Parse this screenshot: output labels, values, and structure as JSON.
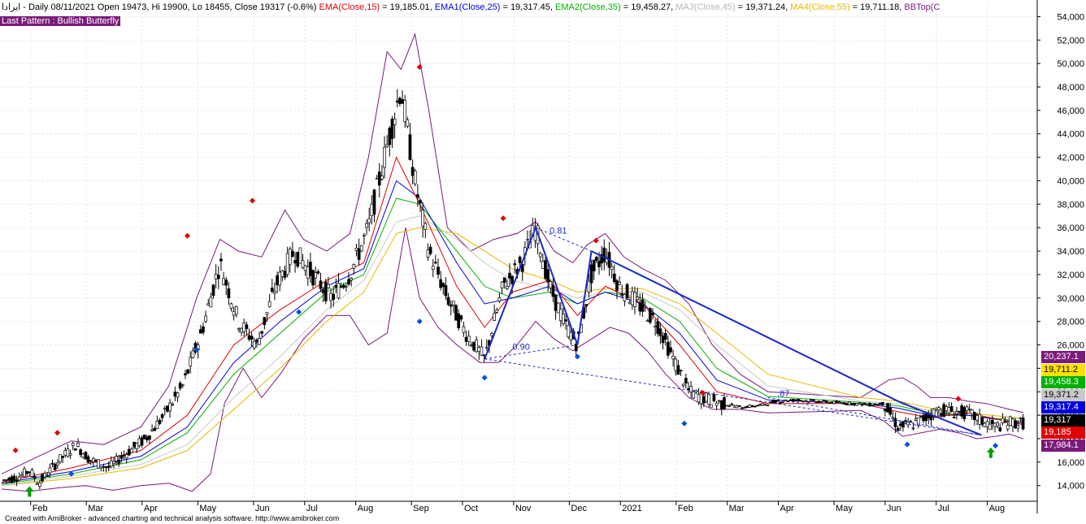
{
  "header": {
    "symbol": "ایرادا",
    "segments": [
      {
        "text": " - Daily 08/11/2021 Open 19473, Hi 19900, Lo 18455, Close 19317 (-0.6%) ",
        "color": "#000000"
      },
      {
        "text": "EMA(Close,15)",
        "color": "#e00000"
      },
      {
        "text": " = 19,185.01, ",
        "color": "#000000"
      },
      {
        "text": "EMA1(Close,25)",
        "color": "#0000e0"
      },
      {
        "text": " = 19,317.45, ",
        "color": "#000000"
      },
      {
        "text": "EMA2(Close,35)",
        "color": "#00b000"
      },
      {
        "text": " = 19,458.27, ",
        "color": "#000000"
      },
      {
        "text": "MA3(Close,45)",
        "color": "#b8b8b8"
      },
      {
        "text": " = 19,371.24, ",
        "color": "#000000"
      },
      {
        "text": "MA4(Close,55)",
        "color": "#e8b800"
      },
      {
        "text": " = 19,711.18, ",
        "color": "#000000"
      },
      {
        "text": "BBTop(C",
        "color": "#7a1a7a"
      }
    ]
  },
  "pattern_label": "Last Pattern : Bullish Butterfly",
  "footer": "Created with AmiBroker - advanced charting and technical analysis software. http://www.amibroker.com",
  "chart_data": {
    "type": "candlestick",
    "ylim": [
      12800,
      55000
    ],
    "y_ticks": [
      14000,
      16000,
      18000,
      20000,
      22000,
      24000,
      26000,
      28000,
      30000,
      32000,
      34000,
      36000,
      38000,
      40000,
      42000,
      44000,
      46000,
      48000,
      50000,
      52000,
      54000
    ],
    "y_tick_labels": [
      "14,000",
      "16,000",
      "18,000",
      "20,000",
      "22,000",
      "24,000",
      "26,000",
      "28,000",
      "30,000",
      "32,000",
      "34,000",
      "36,000",
      "38,000",
      "40,000",
      "42,000",
      "44,000",
      "46,000",
      "48,000",
      "50,000",
      "52,000",
      "54,000"
    ],
    "x_labels": [
      {
        "label": "Feb",
        "x": 0.8
      },
      {
        "label": "Mar",
        "x": 2.0
      },
      {
        "label": "Apr",
        "x": 3.2
      },
      {
        "label": "May",
        "x": 4.4
      },
      {
        "label": "Jun",
        "x": 5.6
      },
      {
        "label": "Jul",
        "x": 6.7
      },
      {
        "label": "Aug",
        "x": 7.8
      },
      {
        "label": "Sep",
        "x": 9.0
      },
      {
        "label": "Oct",
        "x": 10.1
      },
      {
        "label": "Nov",
        "x": 11.2
      },
      {
        "label": "Dec",
        "x": 12.4
      },
      {
        "label": "2021",
        "x": 13.5
      },
      {
        "label": "Feb",
        "x": 14.7
      },
      {
        "label": "Mar",
        "x": 15.8
      },
      {
        "label": "Apr",
        "x": 16.9
      },
      {
        "label": "May",
        "x": 18.1
      },
      {
        "label": "Jun",
        "x": 19.2
      },
      {
        "label": "Jul",
        "x": 20.3
      },
      {
        "label": "Aug",
        "x": 21.4
      }
    ],
    "x_range": [
      0,
      22.3
    ],
    "price_path": [
      [
        0.0,
        14400
      ],
      [
        0.4,
        14800
      ],
      [
        0.6,
        15300
      ],
      [
        0.8,
        14200
      ],
      [
        1.2,
        16000
      ],
      [
        1.6,
        17500
      ],
      [
        1.9,
        16200
      ],
      [
        2.3,
        15500
      ],
      [
        2.7,
        16800
      ],
      [
        3.1,
        18000
      ],
      [
        3.5,
        20000
      ],
      [
        3.9,
        22500
      ],
      [
        4.3,
        27000
      ],
      [
        4.7,
        33000
      ],
      [
        5.1,
        28000
      ],
      [
        5.5,
        26000
      ],
      [
        5.9,
        31000
      ],
      [
        6.3,
        34000
      ],
      [
        6.7,
        32000
      ],
      [
        7.1,
        30000
      ],
      [
        7.5,
        32000
      ],
      [
        7.9,
        36000
      ],
      [
        8.3,
        43000
      ],
      [
        8.6,
        48000
      ],
      [
        8.9,
        40000
      ],
      [
        9.2,
        34000
      ],
      [
        9.6,
        30000
      ],
      [
        10.0,
        27000
      ],
      [
        10.4,
        24800
      ],
      [
        10.8,
        31000
      ],
      [
        11.2,
        33000
      ],
      [
        11.5,
        36000
      ],
      [
        11.8,
        31000
      ],
      [
        12.1,
        28000
      ],
      [
        12.4,
        26000
      ],
      [
        12.7,
        32000
      ],
      [
        13.0,
        34000
      ],
      [
        13.3,
        31000
      ],
      [
        13.7,
        29500
      ],
      [
        14.1,
        28000
      ],
      [
        14.5,
        24500
      ],
      [
        14.8,
        22000
      ],
      [
        15.1,
        21500
      ],
      [
        15.5,
        21000
      ],
      [
        15.9,
        20700
      ],
      [
        16.3,
        20800
      ],
      [
        16.7,
        21200
      ],
      [
        17.1,
        21300
      ],
      [
        17.5,
        21200
      ],
      [
        17.9,
        21100
      ],
      [
        18.3,
        21000
      ],
      [
        18.7,
        20900
      ],
      [
        19.0,
        21000
      ],
      [
        19.3,
        19000
      ],
      [
        19.6,
        19200
      ],
      [
        19.9,
        19800
      ],
      [
        20.2,
        20500
      ],
      [
        20.5,
        20300
      ],
      [
        20.8,
        20200
      ],
      [
        21.1,
        19500
      ],
      [
        21.4,
        19000
      ],
      [
        21.7,
        19400
      ],
      [
        22.0,
        19317
      ]
    ],
    "ema15_path": [
      [
        0.0,
        14300
      ],
      [
        1.5,
        15500
      ],
      [
        3.0,
        17000
      ],
      [
        4.0,
        20000
      ],
      [
        5.0,
        26000
      ],
      [
        6.0,
        29000
      ],
      [
        7.0,
        31500
      ],
      [
        7.8,
        33000
      ],
      [
        8.5,
        42000
      ],
      [
        9.0,
        38000
      ],
      [
        9.8,
        31000
      ],
      [
        10.4,
        27500
      ],
      [
        11.0,
        30500
      ],
      [
        11.8,
        31500
      ],
      [
        12.4,
        28500
      ],
      [
        13.0,
        31000
      ],
      [
        13.8,
        29500
      ],
      [
        14.6,
        26000
      ],
      [
        15.4,
        22000
      ],
      [
        16.5,
        21000
      ],
      [
        18.5,
        21000
      ],
      [
        19.3,
        20300
      ],
      [
        20.0,
        19800
      ],
      [
        20.8,
        20200
      ],
      [
        22.0,
        19185
      ]
    ],
    "ema25_path": [
      [
        0.0,
        14200
      ],
      [
        1.5,
        15200
      ],
      [
        3.0,
        16500
      ],
      [
        4.0,
        19000
      ],
      [
        5.0,
        24500
      ],
      [
        6.0,
        28000
      ],
      [
        7.0,
        31000
      ],
      [
        7.8,
        32500
      ],
      [
        8.5,
        40000
      ],
      [
        9.0,
        38500
      ],
      [
        9.8,
        33000
      ],
      [
        10.4,
        29500
      ],
      [
        11.0,
        30000
      ],
      [
        11.8,
        31000
      ],
      [
        12.4,
        29500
      ],
      [
        13.0,
        30500
      ],
      [
        13.8,
        29500
      ],
      [
        14.6,
        27000
      ],
      [
        15.4,
        23000
      ],
      [
        16.5,
        21300
      ],
      [
        18.5,
        21000
      ],
      [
        19.3,
        20600
      ],
      [
        20.0,
        20000
      ],
      [
        20.8,
        20000
      ],
      [
        22.0,
        19317
      ]
    ],
    "ema35_path": [
      [
        0.0,
        14100
      ],
      [
        1.5,
        15000
      ],
      [
        3.0,
        16200
      ],
      [
        4.0,
        18500
      ],
      [
        5.0,
        23500
      ],
      [
        6.0,
        27000
      ],
      [
        7.0,
        30500
      ],
      [
        7.8,
        32000
      ],
      [
        8.5,
        38500
      ],
      [
        9.0,
        38000
      ],
      [
        9.8,
        34000
      ],
      [
        10.4,
        31000
      ],
      [
        11.0,
        30000
      ],
      [
        11.8,
        30500
      ],
      [
        12.4,
        29500
      ],
      [
        13.0,
        30500
      ],
      [
        13.8,
        30000
      ],
      [
        14.6,
        28000
      ],
      [
        15.4,
        24000
      ],
      [
        16.5,
        21600
      ],
      [
        18.5,
        21100
      ],
      [
        19.3,
        20800
      ],
      [
        20.0,
        20200
      ],
      [
        20.8,
        20000
      ],
      [
        22.0,
        19458
      ]
    ],
    "ma45_path": [
      [
        0.0,
        14000
      ],
      [
        1.5,
        14800
      ],
      [
        3.0,
        15800
      ],
      [
        4.0,
        17500
      ],
      [
        5.0,
        21500
      ],
      [
        6.0,
        25000
      ],
      [
        7.0,
        29000
      ],
      [
        7.8,
        31500
      ],
      [
        8.5,
        36500
      ],
      [
        9.0,
        37000
      ],
      [
        9.8,
        35000
      ],
      [
        10.4,
        33000
      ],
      [
        11.0,
        31500
      ],
      [
        11.8,
        30800
      ],
      [
        12.4,
        30000
      ],
      [
        13.0,
        30500
      ],
      [
        13.8,
        30500
      ],
      [
        14.6,
        29000
      ],
      [
        15.4,
        26000
      ],
      [
        16.5,
        22500
      ],
      [
        18.5,
        21200
      ],
      [
        19.3,
        21000
      ],
      [
        20.0,
        20400
      ],
      [
        20.8,
        20000
      ],
      [
        22.0,
        19371
      ]
    ],
    "ma55_path": [
      [
        0.0,
        14000
      ],
      [
        1.5,
        14600
      ],
      [
        3.0,
        15500
      ],
      [
        4.0,
        17000
      ],
      [
        5.0,
        20500
      ],
      [
        6.0,
        24000
      ],
      [
        7.0,
        28000
      ],
      [
        7.8,
        30500
      ],
      [
        8.5,
        35500
      ],
      [
        9.0,
        36000
      ],
      [
        9.8,
        35500
      ],
      [
        10.4,
        34000
      ],
      [
        11.0,
        32500
      ],
      [
        11.8,
        31500
      ],
      [
        12.4,
        30500
      ],
      [
        13.0,
        30800
      ],
      [
        13.8,
        30800
      ],
      [
        14.6,
        29500
      ],
      [
        15.4,
        27000
      ],
      [
        16.5,
        23500
      ],
      [
        18.5,
        21500
      ],
      [
        19.3,
        21200
      ],
      [
        20.0,
        20600
      ],
      [
        20.8,
        20200
      ],
      [
        22.0,
        19711
      ]
    ],
    "bb_top_path": [
      [
        0.0,
        15000
      ],
      [
        0.8,
        16500
      ],
      [
        1.5,
        17800
      ],
      [
        2.2,
        17500
      ],
      [
        3.0,
        19000
      ],
      [
        3.6,
        22500
      ],
      [
        4.2,
        30000
      ],
      [
        4.7,
        35000
      ],
      [
        5.1,
        34000
      ],
      [
        5.6,
        33500
      ],
      [
        6.1,
        37500
      ],
      [
        6.5,
        35000
      ],
      [
        7.0,
        34000
      ],
      [
        7.5,
        35500
      ],
      [
        7.9,
        42000
      ],
      [
        8.3,
        51000
      ],
      [
        8.6,
        49500
      ],
      [
        8.9,
        52500
      ],
      [
        9.2,
        46000
      ],
      [
        9.6,
        36000
      ],
      [
        10.1,
        34000
      ],
      [
        10.6,
        35000
      ],
      [
        11.1,
        35500
      ],
      [
        11.5,
        36500
      ],
      [
        11.9,
        34000
      ],
      [
        12.3,
        33000
      ],
      [
        12.6,
        34500
      ],
      [
        13.0,
        35500
      ],
      [
        13.4,
        33500
      ],
      [
        13.8,
        32500
      ],
      [
        14.3,
        31500
      ],
      [
        14.8,
        29500
      ],
      [
        15.3,
        26000
      ],
      [
        15.9,
        23500
      ],
      [
        16.5,
        22000
      ],
      [
        18.5,
        21500
      ],
      [
        19.1,
        23000
      ],
      [
        19.4,
        23200
      ],
      [
        19.7,
        22500
      ],
      [
        20.0,
        21500
      ],
      [
        20.4,
        21500
      ],
      [
        20.8,
        21200
      ],
      [
        21.2,
        21000
      ],
      [
        21.7,
        20500
      ],
      [
        22.0,
        20237
      ]
    ],
    "bb_bot_path": [
      [
        0.0,
        13700
      ],
      [
        0.6,
        13500
      ],
      [
        1.2,
        13800
      ],
      [
        1.8,
        14000
      ],
      [
        2.4,
        13600
      ],
      [
        3.0,
        14000
      ],
      [
        3.6,
        14200
      ],
      [
        4.1,
        13500
      ],
      [
        4.5,
        15000
      ],
      [
        4.8,
        21000
      ],
      [
        5.2,
        24000
      ],
      [
        5.6,
        21500
      ],
      [
        6.0,
        23500
      ],
      [
        6.5,
        26500
      ],
      [
        7.0,
        28500
      ],
      [
        7.5,
        28500
      ],
      [
        7.9,
        26000
      ],
      [
        8.3,
        27000
      ],
      [
        8.7,
        36000
      ],
      [
        9.0,
        30000
      ],
      [
        9.4,
        27500
      ],
      [
        9.8,
        26000
      ],
      [
        10.3,
        24500
      ],
      [
        10.7,
        24500
      ],
      [
        11.1,
        26000
      ],
      [
        11.5,
        28000
      ],
      [
        11.9,
        26500
      ],
      [
        12.3,
        25500
      ],
      [
        12.7,
        26500
      ],
      [
        13.1,
        27500
      ],
      [
        13.5,
        27000
      ],
      [
        13.9,
        25500
      ],
      [
        14.3,
        23500
      ],
      [
        14.8,
        21500
      ],
      [
        15.3,
        20500
      ],
      [
        15.9,
        20500
      ],
      [
        16.5,
        20200
      ],
      [
        18.5,
        20400
      ],
      [
        19.0,
        19500
      ],
      [
        19.4,
        18200
      ],
      [
        19.8,
        18500
      ],
      [
        20.2,
        18800
      ],
      [
        20.6,
        18500
      ],
      [
        21.0,
        18000
      ],
      [
        21.4,
        18200
      ],
      [
        21.7,
        18400
      ],
      [
        22.0,
        17984
      ]
    ],
    "pattern_lines": [
      [
        [
          10.4,
          24800
        ],
        [
          11.5,
          36000
        ]
      ],
      [
        [
          11.5,
          36000
        ],
        [
          12.4,
          26000
        ]
      ],
      [
        [
          12.4,
          26000
        ],
        [
          12.7,
          34000
        ]
      ],
      [
        [
          12.7,
          34000
        ],
        [
          19.3,
          21200
        ]
      ],
      [
        [
          19.3,
          21200
        ],
        [
          21.1,
          18300
        ]
      ]
    ],
    "dashed_lines": [
      [
        [
          10.4,
          24800
        ],
        [
          12.4,
          26000
        ]
      ],
      [
        [
          11.5,
          36000
        ],
        [
          12.7,
          34000
        ]
      ],
      [
        [
          10.4,
          24800
        ],
        [
          21.1,
          18300
        ]
      ],
      [
        [
          16.5,
          21500
        ],
        [
          21.1,
          18300
        ]
      ]
    ],
    "ratio_labels": [
      {
        "text": "0.81",
        "x": 11.8,
        "y": 35500
      },
      {
        "text": "0.90",
        "x": 11.0,
        "y": 25600
      },
      {
        "text": ".87",
        "x": 16.7,
        "y": 21600
      }
    ],
    "peak_markers": [
      [
        0.3,
        17000
      ],
      [
        1.2,
        18500
      ],
      [
        4.0,
        35300
      ],
      [
        5.4,
        38300
      ],
      [
        9.0,
        49700
      ],
      [
        10.8,
        36800
      ],
      [
        12.8,
        34900
      ],
      [
        15.1,
        21900
      ],
      [
        20.6,
        21400
      ]
    ],
    "trough_markers": [
      [
        1.5,
        15000
      ],
      [
        4.2,
        25600
      ],
      [
        6.4,
        28800
      ],
      [
        9.0,
        28000
      ],
      [
        10.4,
        23200
      ],
      [
        12.4,
        25000
      ],
      [
        14.7,
        19300
      ],
      [
        19.5,
        17500
      ],
      [
        21.4,
        17400
      ]
    ],
    "buy_arrows": [
      [
        0.6,
        13400
      ],
      [
        21.3,
        16700
      ]
    ],
    "price_tags": [
      {
        "label": "20,237.1",
        "value": 20237.1,
        "bg": "#7a1a7a",
        "fg": "#ffffff"
      },
      {
        "label": "19,711.2",
        "value": 19711.2,
        "bg": "#ffe000",
        "fg": "#000000"
      },
      {
        "label": "19,458.3",
        "value": 19458.3,
        "bg": "#00b000",
        "fg": "#ffffff"
      },
      {
        "label": "19,371.2",
        "value": 19371.2,
        "bg": "#c8c8c8",
        "fg": "#000000"
      },
      {
        "label": "19,317.4",
        "value": 19317.4,
        "bg": "#0000e0",
        "fg": "#ffffff"
      },
      {
        "label": "19,317",
        "value": 19317,
        "bg": "#000000",
        "fg": "#ffffff"
      },
      {
        "label": "19,185",
        "value": 19185,
        "bg": "#e00000",
        "fg": "#ffffff"
      },
      {
        "label": "17,984.1",
        "value": 17984.1,
        "bg": "#7a1a7a",
        "fg": "#ffffff"
      }
    ],
    "colors": {
      "ema15": "#e00000",
      "ema25": "#0000e0",
      "ema35": "#00b000",
      "ma45": "#c8c8c8",
      "ma55": "#e8b800",
      "bb": "#7a1a7a",
      "pattern": "#1a28c8",
      "candle": "#000000",
      "peak": "#e00000",
      "trough": "#0050e0",
      "arrow": "#00a000"
    },
    "grid": true
  }
}
